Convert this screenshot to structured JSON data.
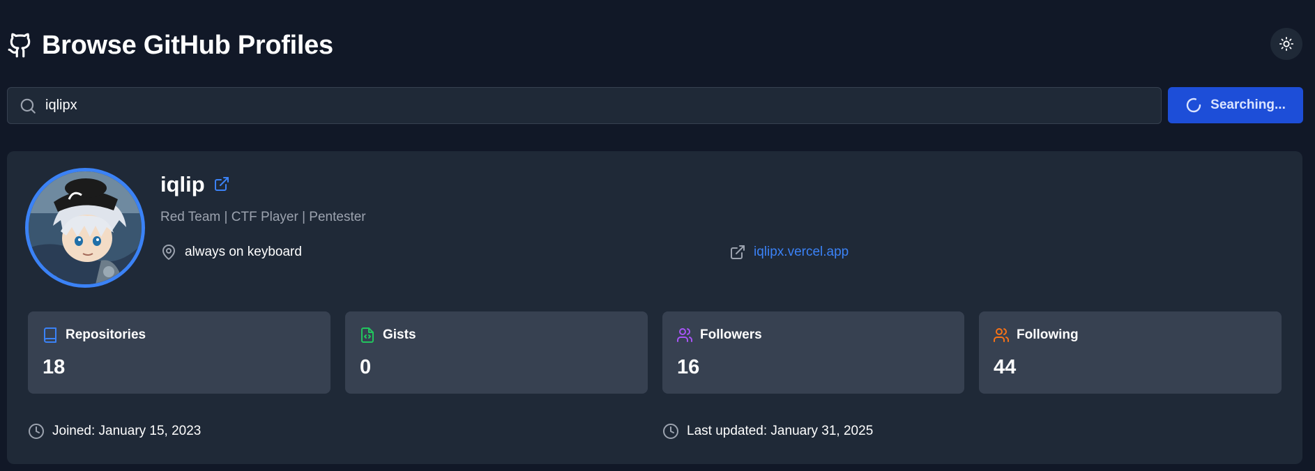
{
  "header": {
    "title": "Browse GitHub Profiles",
    "logo_icon": "github-icon",
    "theme_toggle_icon": "sun-icon"
  },
  "search": {
    "value": "iqlipx",
    "placeholder": "",
    "button_label": "Searching...",
    "button_icon": "spinner-icon"
  },
  "profile": {
    "username": "iqlip",
    "bio": "Red Team | CTF Player | Pentester",
    "location": "always on keyboard",
    "website": "iqlipx.vercel.app"
  },
  "stats": [
    {
      "label": "Repositories",
      "value": "18",
      "icon": "book-icon",
      "color": "#3b82f6"
    },
    {
      "label": "Gists",
      "value": "0",
      "icon": "file-code-icon",
      "color": "#22c55e"
    },
    {
      "label": "Followers",
      "value": "16",
      "icon": "users-icon",
      "color": "#a855f7"
    },
    {
      "label": "Following",
      "value": "44",
      "icon": "users-icon",
      "color": "#f97316"
    }
  ],
  "meta": {
    "joined": "Joined: January 15, 2023",
    "updated": "Last updated: January 31, 2025"
  },
  "colors": {
    "background": "#111827",
    "card": "#1f2937",
    "stat_card": "#374151",
    "accent": "#3b82f6",
    "button": "#1d4ed8"
  }
}
